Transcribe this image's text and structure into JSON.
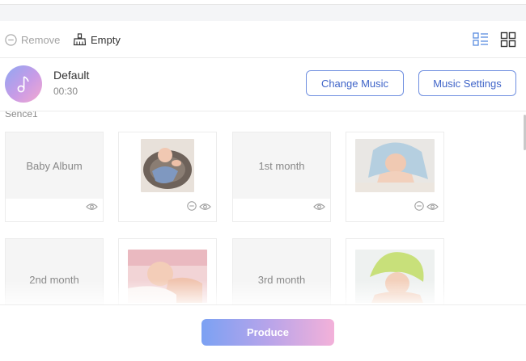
{
  "toolbar": {
    "remove_label": "Remove",
    "empty_label": "Empty"
  },
  "music": {
    "name": "Default",
    "duration": "00:30",
    "change_label": "Change Music",
    "settings_label": "Music Settings"
  },
  "scene": {
    "label": "Sence1",
    "cards": [
      {
        "type": "text",
        "title": "Baby Album"
      },
      {
        "type": "photo",
        "icon": "baby-in-basket-photo"
      },
      {
        "type": "text",
        "title": "1st month"
      },
      {
        "type": "photo",
        "icon": "baby-blue-towel-photo"
      },
      {
        "type": "text",
        "title": "2nd month"
      },
      {
        "type": "photo",
        "icon": "baby-on-pillow-photo"
      },
      {
        "type": "text",
        "title": "3rd month"
      },
      {
        "type": "photo",
        "icon": "baby-green-towel-photo"
      }
    ]
  },
  "footer": {
    "produce_label": "Produce"
  },
  "colors": {
    "accent": "#3f64c8",
    "produce_gradient_start": "#7ba1f3",
    "produce_gradient_end": "#f3b1d9"
  }
}
